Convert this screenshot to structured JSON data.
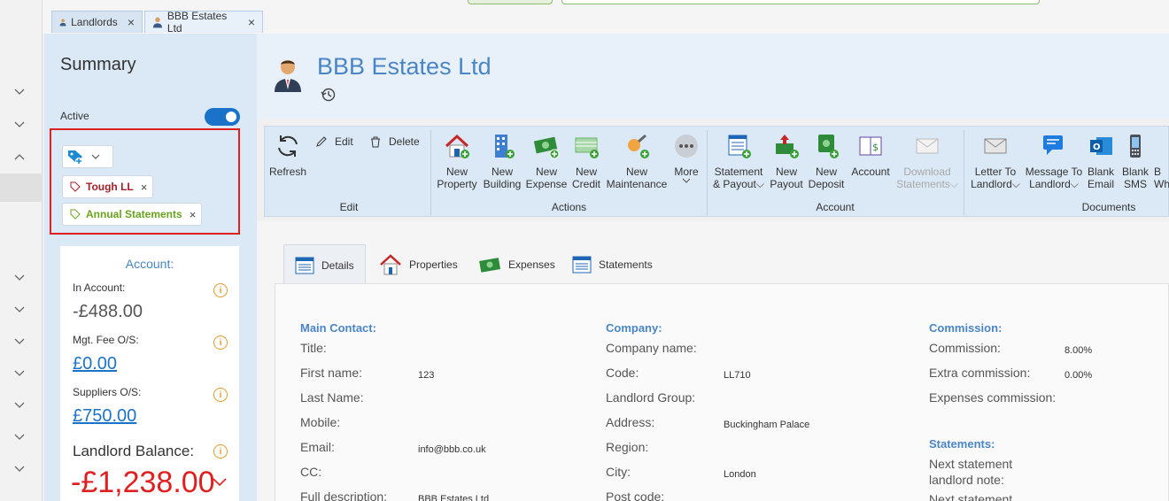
{
  "tabs": [
    {
      "label": "Landlords"
    },
    {
      "label": "BBB Estates Ltd"
    }
  ],
  "summary": {
    "title": "Summary",
    "active_label": "Active",
    "tags": [
      "Tough LL",
      "Annual Statements"
    ],
    "account": {
      "title": "Account:",
      "in_account_label": "In Account:",
      "in_account_value": "-£488.00",
      "mgt_fee_label": "Mgt. Fee O/S:",
      "mgt_fee_value": "£0.00",
      "suppliers_label": "Suppliers O/S:",
      "suppliers_value": "£750.00",
      "balance_label": "Landlord Balance:",
      "balance_value": "-£1,238.00"
    }
  },
  "header": {
    "title": "BBB Estates Ltd"
  },
  "ribbon": {
    "refresh": "Refresh",
    "edit": "Edit",
    "delete": "Delete",
    "groups": {
      "edit": "Edit",
      "actions": "Actions",
      "account": "Account",
      "documents": "Documents"
    },
    "new_property": [
      "New",
      "Property"
    ],
    "new_building": [
      "New",
      "Building"
    ],
    "new_expense": [
      "New",
      "Expense"
    ],
    "new_credit": [
      "New",
      "Credit"
    ],
    "new_maintenance": [
      "New",
      "Maintenance"
    ],
    "more": "More",
    "statement_payout": [
      "Statement",
      "& Payout"
    ],
    "new_payout": [
      "New",
      "Payout"
    ],
    "new_deposit": [
      "New",
      "Deposit"
    ],
    "account": "Account",
    "download_statements": [
      "Download",
      "Statements"
    ],
    "letter_to_landlord": [
      "Letter To",
      "Landlord"
    ],
    "message_to_landlord": [
      "Message To",
      "Landlord"
    ],
    "blank_email": [
      "Blank",
      "Email"
    ],
    "blank_sms": [
      "Blank",
      "SMS"
    ],
    "blank_whatsapp": [
      "B",
      "Wh"
    ]
  },
  "content_tabs": [
    "Details",
    "Properties",
    "Expenses",
    "Statements"
  ],
  "details": {
    "main_contact": {
      "heading": "Main Contact:",
      "fields": [
        {
          "label": "Title:",
          "value": ""
        },
        {
          "label": "First name:",
          "value": "123"
        },
        {
          "label": "Last Name:",
          "value": ""
        },
        {
          "label": "Mobile:",
          "value": ""
        },
        {
          "label": "Email:",
          "value": "info@bbb.co.uk"
        },
        {
          "label": "CC:",
          "value": ""
        },
        {
          "label": "Full description:",
          "value": "BBB Estates Ltd"
        }
      ]
    },
    "company": {
      "heading": "Company:",
      "fields": [
        {
          "label": "Company name:",
          "value": ""
        },
        {
          "label": "Code:",
          "value": "LL710"
        },
        {
          "label": "Landlord Group:",
          "value": ""
        },
        {
          "label": "Address:",
          "value": "Buckingham Palace"
        },
        {
          "label": "Region:",
          "value": ""
        },
        {
          "label": "City:",
          "value": "London"
        },
        {
          "label": "Post code:",
          "value": ""
        }
      ]
    },
    "commission": {
      "heading": "Commission:",
      "fields": [
        {
          "label": "Commission:",
          "value": "8.00%"
        },
        {
          "label": "Extra commission:",
          "value": "0.00%"
        },
        {
          "label": "Expenses commission:",
          "value": ""
        }
      ]
    },
    "statements": {
      "heading": "Statements:",
      "next_note_label_1": "Next statement",
      "next_note_label_2": "landlord note:",
      "next_statement_label": "Next statement"
    }
  },
  "colors": {
    "accent": "#4a86c5",
    "negative": "#e02020",
    "toggle": "#1a73c8",
    "tag_red": "#a3202a",
    "tag_green": "#6aa31d"
  }
}
